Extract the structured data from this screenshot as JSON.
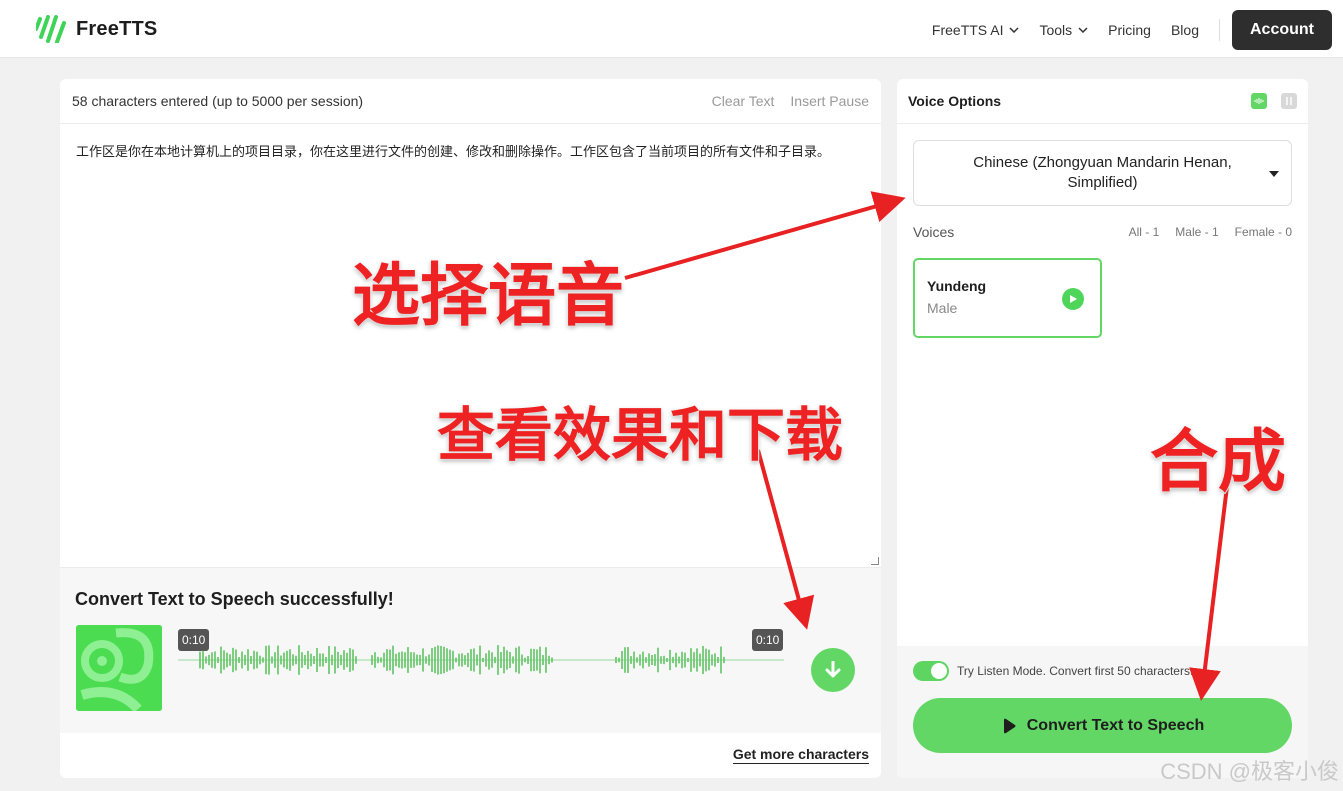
{
  "header": {
    "logo_text": "FreeTTS",
    "nav": [
      {
        "label": "FreeTTS AI",
        "has_dropdown": true
      },
      {
        "label": "Tools",
        "has_dropdown": true
      },
      {
        "label": "Pricing",
        "has_dropdown": false
      },
      {
        "label": "Blog",
        "has_dropdown": false
      }
    ],
    "account_label": "Account"
  },
  "editor": {
    "char_count": "58 characters entered (up to 5000 per session)",
    "clear_text": "Clear Text",
    "insert_pause": "Insert Pause",
    "content": "工作区是你在本地计算机上的项目目录，你在这里进行文件的创建、修改和删除操作。工作区包含了当前项目的所有文件和子目录。"
  },
  "result": {
    "title": "Convert Text to Speech successfully!",
    "time_start": "0:10",
    "time_end": "0:10",
    "more_link": "Get more characters"
  },
  "voice_options": {
    "title": "Voice Options",
    "language": "Chinese (Zhongyuan Mandarin Henan, Simplified)",
    "voices_label": "Voices",
    "filters": {
      "all": "All - 1",
      "male": "Male - 1",
      "female": "Female - 0"
    },
    "voice": {
      "name": "Yundeng",
      "gender": "Male"
    },
    "listen_mode_text": "Try Listen Mode. Convert first 50 characters.",
    "listen_mode_on": true,
    "convert_label": "Convert Text to Speech"
  },
  "annotations": {
    "select_voice": "选择语音",
    "check_and_download": "查看效果和下载",
    "synthesize": "合成"
  },
  "watermark": "CSDN @极客小俊",
  "colors": {
    "accent": "#63d765",
    "annotation_red": "#ee2222",
    "dark_button": "#2e2e2e"
  }
}
